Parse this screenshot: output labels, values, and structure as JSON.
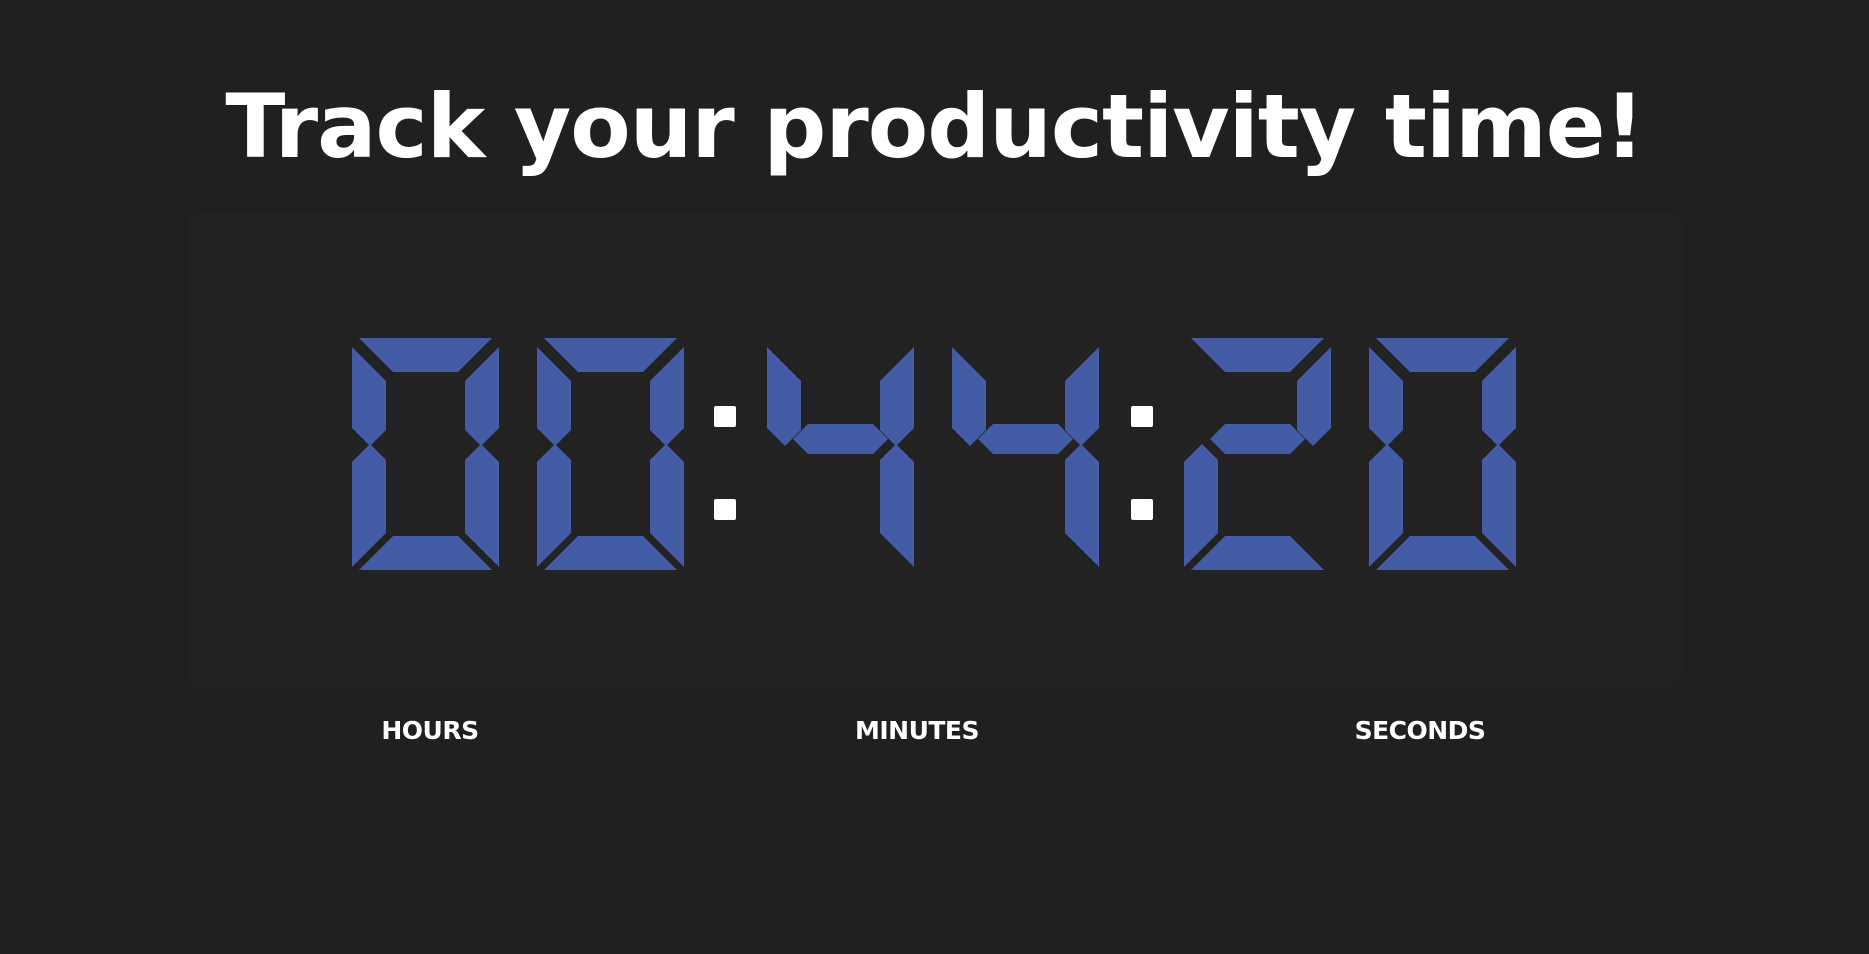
{
  "page": {
    "title": "Track your productivity time!"
  },
  "timer": {
    "display": "00:44:20",
    "hours": "00",
    "minutes": "44",
    "seconds": "20",
    "digit_color": "#445ca5",
    "colon_color": "#ffffff"
  },
  "labels": {
    "hours": "HOURS",
    "minutes": "MINUTES",
    "seconds": "SECONDS"
  },
  "colors": {
    "background": "#202020",
    "panel": "#222222",
    "text": "#ffffff"
  }
}
